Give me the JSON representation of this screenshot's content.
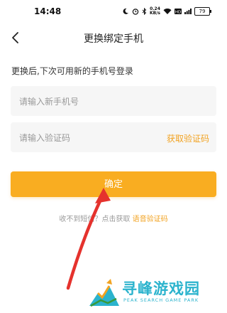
{
  "status_bar": {
    "time": "14:48",
    "net_speed_value": "0.24",
    "net_speed_unit": "KB/s",
    "battery": "79"
  },
  "nav": {
    "title": "更换绑定手机"
  },
  "form": {
    "hint": "更换后,下次可用新的手机号登录",
    "phone_placeholder": "请输入新手机号",
    "code_placeholder": "请输入验证码",
    "get_code_label": "获取验证码",
    "confirm_label": "确定",
    "sms_help_prefix": "收不到短信？点击获取",
    "voice_code_label": "语音验证码"
  },
  "watermark": {
    "title": "寻峰游戏园",
    "subtitle": "PEAK SEARCH GAME PARK"
  },
  "colors": {
    "accent": "#f9ad21",
    "link": "#f2a322",
    "arrow": "#e5322d",
    "watermark": "#2bb3cd"
  }
}
